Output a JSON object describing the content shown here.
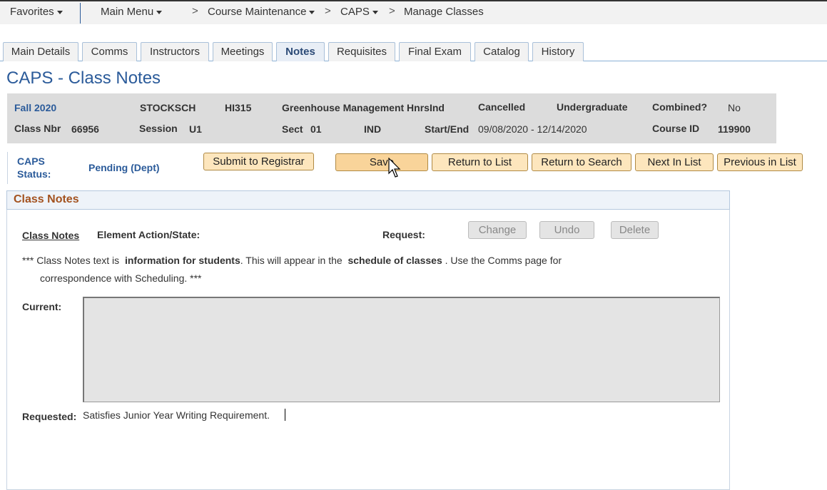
{
  "nav": {
    "favorites": "Favorites",
    "main_menu": "Main Menu",
    "course_maintenance": "Course Maintenance",
    "caps": "CAPS",
    "manage_classes": "Manage Classes",
    "chevron": ">"
  },
  "tabs": [
    {
      "label": "Main Details"
    },
    {
      "label": "Comms"
    },
    {
      "label": "Instructors"
    },
    {
      "label": "Meetings"
    },
    {
      "label": "Notes",
      "active": true
    },
    {
      "label": "Requisites"
    },
    {
      "label": "Final Exam"
    },
    {
      "label": "Catalog"
    },
    {
      "label": "History"
    }
  ],
  "page_title": "CAPS - Class Notes",
  "info": {
    "term": "Fall 2020",
    "subject": "STOCKSCH",
    "catalog": "HI315",
    "course_title": "Greenhouse Management HnrsInd",
    "status": "Cancelled",
    "career": "Undergraduate",
    "combined_label": "Combined?",
    "combined_value": "No",
    "class_nbr_label": "Class Nbr",
    "class_nbr_value": "66956",
    "session_label": "Session",
    "session_value": "U1",
    "sect_label": "Sect",
    "sect_value": "01",
    "component": "IND",
    "start_end_label": "Start/End",
    "start_end_value": "09/08/2020 - 12/14/2020",
    "course_id_label": "Course ID",
    "course_id_value": "119900"
  },
  "caps_status": {
    "label_line1": "CAPS",
    "label_line2": "Status:",
    "value": "Pending (Dept)"
  },
  "buttons": {
    "submit": "Submit to Registrar",
    "save": "Save",
    "return_list": "Return to List",
    "return_search": "Return to Search",
    "next": "Next In List",
    "previous": "Previous in List"
  },
  "notes": {
    "panel_title": "Class Notes",
    "class_notes_label": "Class Notes",
    "element_action_label": "Element Action/State:",
    "request_label": "Request:",
    "change": "Change",
    "undo": "Undo",
    "delete": "Delete",
    "info_prefix": "*** Class Notes text is",
    "info_bold1": "information for students",
    "info_mid": ". This will appear in the",
    "info_bold2": "schedule of classes",
    "info_suffix": ". Use the Comms page for",
    "info_line2": "correspondence with Scheduling. ***",
    "current_label": "Current:",
    "requested_label": "Requested:",
    "requested_value": "Satisfies Junior Year Writing Requirement."
  },
  "colors": {
    "accent_blue": "#2b5b9a",
    "panel_title": "#a3521f",
    "button_bg": "#fde6bd"
  }
}
